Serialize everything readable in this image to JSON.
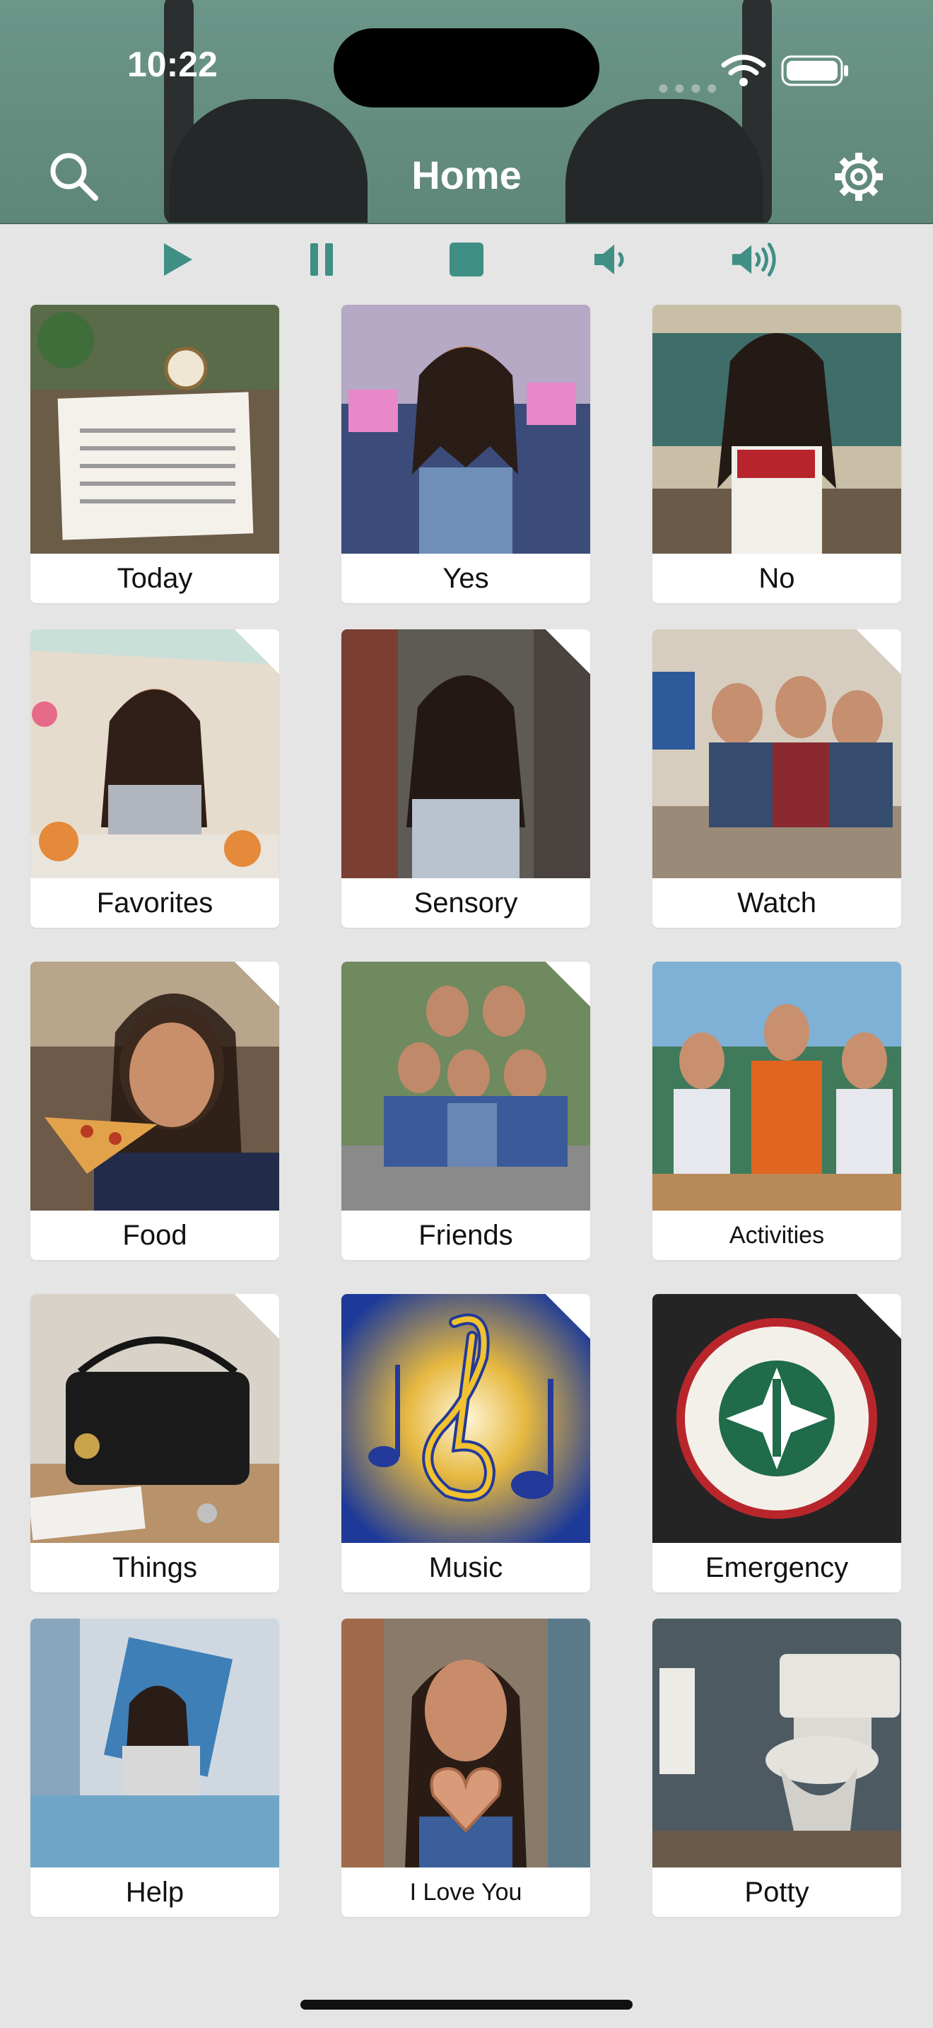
{
  "status": {
    "time": "10:22"
  },
  "header": {
    "title": "Home"
  },
  "toolbar": {
    "play": "play-icon",
    "pause": "pause-icon",
    "stop": "stop-icon",
    "volume_down": "volume-low-icon",
    "volume_up": "volume-high-icon"
  },
  "colors": {
    "header": "#658f82",
    "accent": "#3f8f85",
    "background": "#e5e5e5"
  },
  "tiles": [
    {
      "label": "Today",
      "folder": false
    },
    {
      "label": "Yes",
      "folder": false
    },
    {
      "label": "No",
      "folder": false
    },
    {
      "label": "Favorites",
      "folder": true
    },
    {
      "label": "Sensory",
      "folder": true
    },
    {
      "label": "Watch",
      "folder": true
    },
    {
      "label": "Food",
      "folder": true
    },
    {
      "label": "Friends",
      "folder": true
    },
    {
      "label": "Activities",
      "folder": false
    },
    {
      "label": "Things",
      "folder": true
    },
    {
      "label": "Music",
      "folder": true
    },
    {
      "label": "Emergency",
      "folder": true
    },
    {
      "label": "Help",
      "folder": false
    },
    {
      "label": "I Love You",
      "folder": false
    },
    {
      "label": "Potty",
      "folder": false
    }
  ]
}
